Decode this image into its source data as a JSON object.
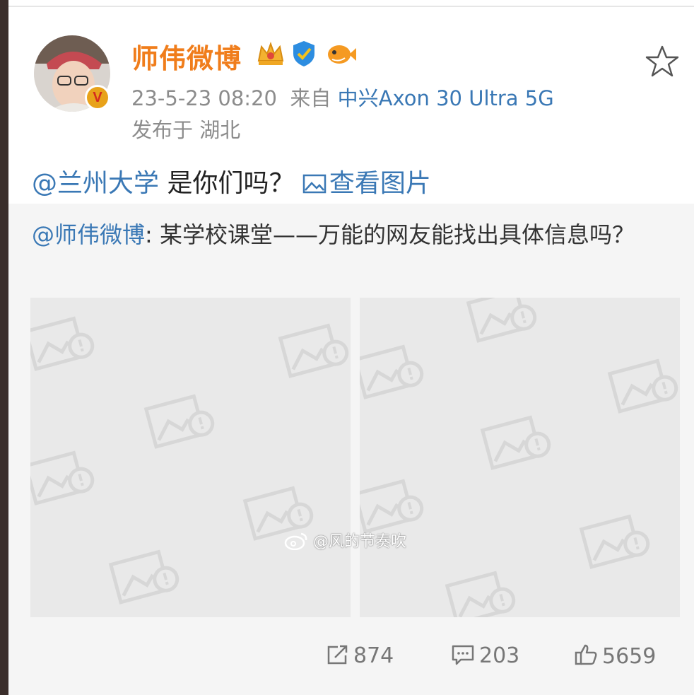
{
  "post": {
    "author": "师伟微博",
    "time": "23-5-23 08:20",
    "from_label": "来自",
    "device": "中兴Axon 30 Ultra 5G",
    "location": "发布于 湖北",
    "text_mention": "@兰州大学",
    "text_body": " 是你们吗？ ",
    "view_pics": "查看图片"
  },
  "repost": {
    "mention": "@师伟微博",
    "text": ": 某学校课堂——万能的网友能找出具体信息吗？",
    "watermark": "@风的节奏吹"
  },
  "actions": {
    "repost_count": "874",
    "comment_count": "203",
    "like_count": "5659"
  },
  "icons": [
    "star-icon",
    "crown-icon",
    "verified-icon",
    "fish-icon",
    "image-icon",
    "repost-icon",
    "comment-icon",
    "like-icon",
    "weibo-logo-icon",
    "image-placeholder-icon"
  ],
  "colors": {
    "name": "#f07d1b",
    "link": "#3a78b5",
    "meta": "#8c8c8c",
    "repost_bg": "#f5f5f5"
  }
}
